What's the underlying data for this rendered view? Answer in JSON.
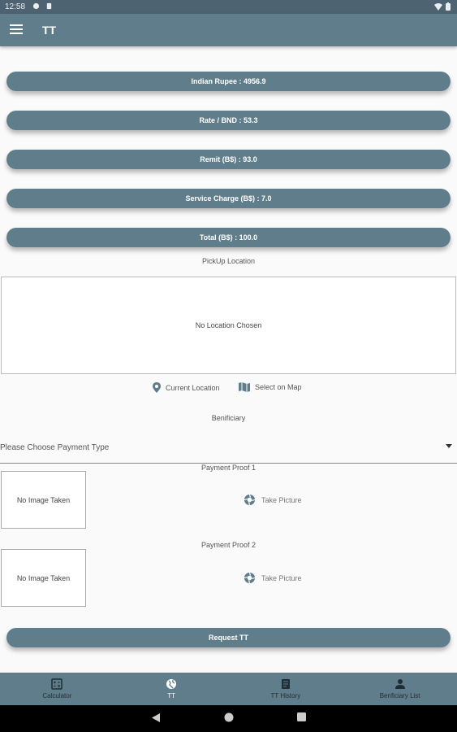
{
  "status_bar": {
    "time": "12:58"
  },
  "app_bar": {
    "title": "TT"
  },
  "summary": {
    "indian_rupee": "Indian Rupee : 4956.9",
    "rate": "Rate / BND : 53.3",
    "remit": "Remit (B$) : 93.0",
    "service_charge": "Service Charge (B$) : 7.0",
    "total": "Total (B$) : 100.0"
  },
  "pickup": {
    "label": "PickUp Location",
    "placeholder": "No Location Chosen",
    "current_location_label": "Current Location",
    "select_on_map_label": "Select on Map"
  },
  "beneficiary": {
    "label": "Benificiary"
  },
  "payment_type": {
    "value": "Please Choose Payment Type"
  },
  "payment_proofs": [
    {
      "label": "Payment Proof 1",
      "image_placeholder": "No Image Taken",
      "take_picture_label": "Take Picture"
    },
    {
      "label": "Payment Proof 2",
      "image_placeholder": "No Image Taken",
      "take_picture_label": "Take Picture"
    }
  ],
  "request_button": {
    "label": "Request TT"
  },
  "bottom_nav": {
    "items": [
      {
        "label": "Calculator",
        "icon": "calculator-icon"
      },
      {
        "label": "TT",
        "icon": "globe-icon",
        "active": true
      },
      {
        "label": "TT History",
        "icon": "receipt-icon"
      },
      {
        "label": "Benficiary List",
        "icon": "person-icon"
      }
    ]
  },
  "colors": {
    "primary": "#607d8b",
    "status_bar": "#4d6371",
    "background": "#fafafa"
  }
}
